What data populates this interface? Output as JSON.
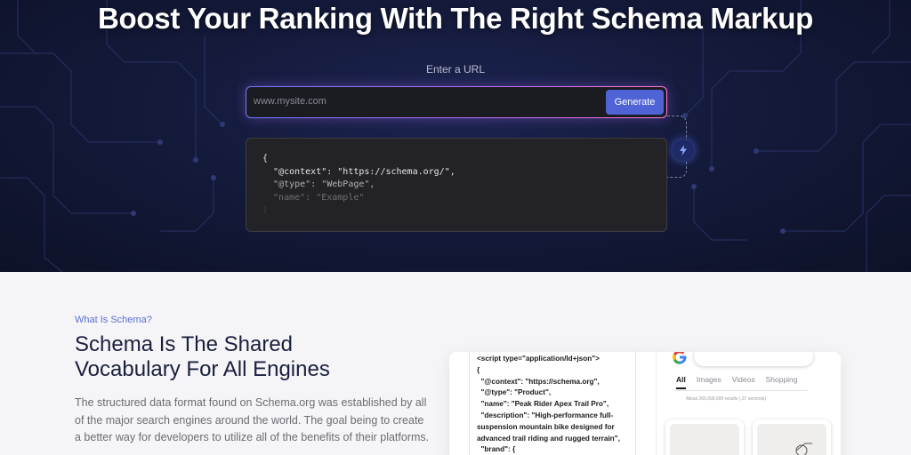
{
  "hero": {
    "title": "Boost Your Ranking With The Right Schema Markup",
    "url_label": "Enter a URL",
    "url_placeholder": "www.mysite.com",
    "generate_label": "Generate",
    "code_lines": [
      "{",
      "  \"@context\": \"https://schema.org/\",",
      "  \"@type\": \"WebPage\",",
      "  \"name\": \"Example\"",
      "}"
    ],
    "bolt_icon": "lightning-icon"
  },
  "schema_section": {
    "eyebrow": "What Is Schema?",
    "title": "Schema Is The Shared Vocabulary For All Engines",
    "body": "The structured data format found on Schema.org was established by all of the major search engines around the world. The goal being to create a better way for developers to utilize all of the benefits of their platforms."
  },
  "preview": {
    "code_lines": [
      "<script type=\"application/ld+json\">",
      "{",
      "  \"@context\": \"https://schema.org\",",
      "  \"@type\": \"Product\",",
      "  \"name\": \"Peak Rider Apex Trail Pro\",",
      "  \"description\": \"High-performance full-",
      "suspension mountain bike designed for",
      "advanced trail riding and rugged terrain\",",
      "  \"brand\": {"
    ],
    "search_tabs": [
      "All",
      "Images",
      "Videos",
      "Shopping"
    ],
    "result_count": "About 265,000,000 results (.37 seconds)"
  },
  "colors": {
    "accent": "#4f63d6",
    "eyebrow": "#5b6fd8",
    "heading": "#1a1f3d"
  }
}
